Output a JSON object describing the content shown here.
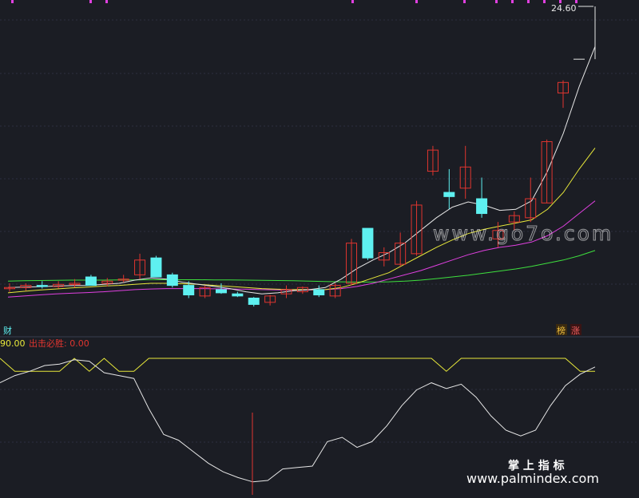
{
  "colors": {
    "background": "#1b1d24",
    "grid": "#2c3040",
    "up": "#e0352f",
    "down": "#5ef0f0",
    "ma_short": "#e6e6e6",
    "ma_mid": "#e8e83a",
    "ma_long": "#e040e0",
    "ma_xlong": "#3ee03e",
    "osc_line": "#e6e6e6",
    "signal_line": "#e8e83a",
    "signal_marker": "#e0352f"
  },
  "top_panel": {
    "price_high_label": "24.60",
    "left_tag": "财",
    "right_tags": [
      "榜",
      "涨"
    ]
  },
  "bottom_panel": {
    "value_left": "90.00",
    "indicator_label": "出击必胜: 0.00"
  },
  "watermarks": {
    "site_mid": "www.go7o.com",
    "brand": "掌 上 指 标",
    "site_bottom": "www.palmindex.com"
  },
  "chart_data": [
    {
      "type": "candlestick",
      "title": "",
      "y_ticks_shown": [
        "24.60"
      ],
      "ylim": [
        9.8,
        24.9
      ],
      "grid": true,
      "candles": [
        {
          "o": 11.3,
          "h": 11.5,
          "l": 11.1,
          "c": 11.3
        },
        {
          "o": 11.3,
          "h": 11.5,
          "l": 11.15,
          "c": 11.4
        },
        {
          "o": 11.4,
          "h": 11.6,
          "l": 11.25,
          "c": 11.35
        },
        {
          "o": 11.35,
          "h": 11.6,
          "l": 11.25,
          "c": 11.45
        },
        {
          "o": 11.45,
          "h": 11.7,
          "l": 11.3,
          "c": 11.5
        },
        {
          "o": 11.8,
          "h": 11.9,
          "l": 11.4,
          "c": 11.4
        },
        {
          "o": 11.5,
          "h": 11.75,
          "l": 11.35,
          "c": 11.6
        },
        {
          "o": 11.65,
          "h": 11.9,
          "l": 11.55,
          "c": 11.7
        },
        {
          "o": 11.9,
          "h": 12.9,
          "l": 11.7,
          "c": 12.6
        },
        {
          "o": 12.7,
          "h": 12.8,
          "l": 11.8,
          "c": 11.8
        },
        {
          "o": 11.9,
          "h": 12.0,
          "l": 11.3,
          "c": 11.4
        },
        {
          "o": 11.4,
          "h": 11.6,
          "l": 10.8,
          "c": 10.95
        },
        {
          "o": 10.9,
          "h": 11.4,
          "l": 10.8,
          "c": 11.3
        },
        {
          "o": 11.2,
          "h": 11.5,
          "l": 11.0,
          "c": 11.05
        },
        {
          "o": 11.0,
          "h": 11.1,
          "l": 10.85,
          "c": 10.9
        },
        {
          "o": 10.8,
          "h": 10.85,
          "l": 10.4,
          "c": 10.5
        },
        {
          "o": 10.6,
          "h": 10.95,
          "l": 10.45,
          "c": 10.9
        },
        {
          "o": 11.0,
          "h": 11.4,
          "l": 10.8,
          "c": 11.2
        },
        {
          "o": 11.1,
          "h": 11.35,
          "l": 11.0,
          "c": 11.3
        },
        {
          "o": 11.2,
          "h": 11.4,
          "l": 10.85,
          "c": 10.95
        },
        {
          "o": 10.9,
          "h": 11.5,
          "l": 10.8,
          "c": 11.4
        },
        {
          "o": 11.5,
          "h": 13.6,
          "l": 11.4,
          "c": 13.4
        },
        {
          "o": 14.1,
          "h": 14.1,
          "l": 12.6,
          "c": 12.7
        },
        {
          "o": 12.6,
          "h": 13.2,
          "l": 12.3,
          "c": 12.95
        },
        {
          "o": 12.4,
          "h": 13.9,
          "l": 12.3,
          "c": 13.4
        },
        {
          "o": 12.9,
          "h": 15.4,
          "l": 12.8,
          "c": 15.2
        },
        {
          "o": 16.8,
          "h": 18.0,
          "l": 16.6,
          "c": 17.8
        },
        {
          "o": 15.8,
          "h": 16.9,
          "l": 15.0,
          "c": 15.6
        },
        {
          "o": 16.0,
          "h": 18.0,
          "l": 15.5,
          "c": 17.0
        },
        {
          "o": 15.5,
          "h": 16.5,
          "l": 14.6,
          "c": 14.8
        },
        {
          "o": 13.6,
          "h": 14.4,
          "l": 13.2,
          "c": 14.0
        },
        {
          "o": 14.4,
          "h": 14.9,
          "l": 14.0,
          "c": 14.7
        },
        {
          "o": 14.6,
          "h": 16.5,
          "l": 14.4,
          "c": 15.5
        },
        {
          "o": 15.3,
          "h": 18.3,
          "l": 15.3,
          "c": 18.2
        },
        {
          "o": 20.5,
          "h": 21.1,
          "l": 19.8,
          "c": 21.0
        }
      ],
      "ma_short": [
        11.3,
        11.32,
        11.34,
        11.37,
        11.39,
        11.4,
        11.45,
        11.5,
        11.65,
        11.75,
        11.7,
        11.55,
        11.45,
        11.35,
        11.25,
        11.1,
        11.0,
        11.05,
        11.15,
        11.2,
        11.3,
        11.7,
        12.2,
        12.6,
        12.95,
        13.4,
        14.0,
        14.6,
        15.1,
        15.35,
        15.2,
        14.95,
        15.0,
        15.4,
        16.8,
        18.6,
        20.8,
        22.7
      ],
      "ma_mid": [
        11.05,
        11.12,
        11.18,
        11.23,
        11.28,
        11.32,
        11.37,
        11.4,
        11.45,
        11.5,
        11.5,
        11.48,
        11.45,
        11.4,
        11.35,
        11.3,
        11.25,
        11.22,
        11.2,
        11.2,
        11.2,
        11.3,
        11.5,
        11.75,
        12.0,
        12.4,
        12.8,
        13.2,
        13.55,
        13.85,
        14.05,
        14.2,
        14.35,
        14.5,
        15.0,
        15.8,
        16.9,
        17.9
      ],
      "ma_long": [
        10.85,
        10.9,
        10.95,
        11.0,
        11.03,
        11.06,
        11.1,
        11.15,
        11.2,
        11.23,
        11.25,
        11.25,
        11.25,
        11.24,
        11.23,
        11.22,
        11.2,
        11.19,
        11.18,
        11.18,
        11.2,
        11.25,
        11.35,
        11.5,
        11.7,
        11.9,
        12.1,
        12.35,
        12.6,
        12.85,
        13.05,
        13.2,
        13.3,
        13.45,
        13.75,
        14.2,
        14.8,
        15.4
      ],
      "ma_xlong": [
        11.6,
        11.62,
        11.63,
        11.64,
        11.65,
        11.65,
        11.65,
        11.66,
        11.66,
        11.67,
        11.67,
        11.67,
        11.67,
        11.66,
        11.66,
        11.65,
        11.64,
        11.63,
        11.62,
        11.6,
        11.58,
        11.57,
        11.56,
        11.56,
        11.57,
        11.6,
        11.65,
        11.72,
        11.8,
        11.88,
        11.98,
        12.08,
        12.18,
        12.3,
        12.45,
        12.6,
        12.8,
        13.05
      ],
      "last_spike": {
        "high": 24.6,
        "low": 22.1
      }
    },
    {
      "type": "line",
      "title": "",
      "ylim": [
        0,
        100
      ],
      "osc": [
        78,
        83,
        86,
        90,
        91,
        94,
        93,
        85,
        83,
        81,
        60,
        42,
        38,
        30,
        22,
        16,
        12,
        9,
        10,
        18,
        19,
        20,
        37,
        40,
        33,
        37,
        48,
        62,
        73,
        78,
        74,
        77,
        68,
        55,
        45,
        41,
        45,
        62,
        76,
        84,
        89
      ],
      "signal": [
        95,
        86,
        86,
        86,
        86,
        95,
        86,
        95,
        86,
        86,
        95,
        95,
        95,
        95,
        95,
        95,
        95,
        95,
        95,
        95,
        95,
        95,
        95,
        95,
        95,
        95,
        95,
        95,
        95,
        95,
        86,
        95,
        95,
        95,
        95,
        95,
        95,
        95,
        95,
        86,
        86
      ],
      "marker_index": 16
    }
  ]
}
